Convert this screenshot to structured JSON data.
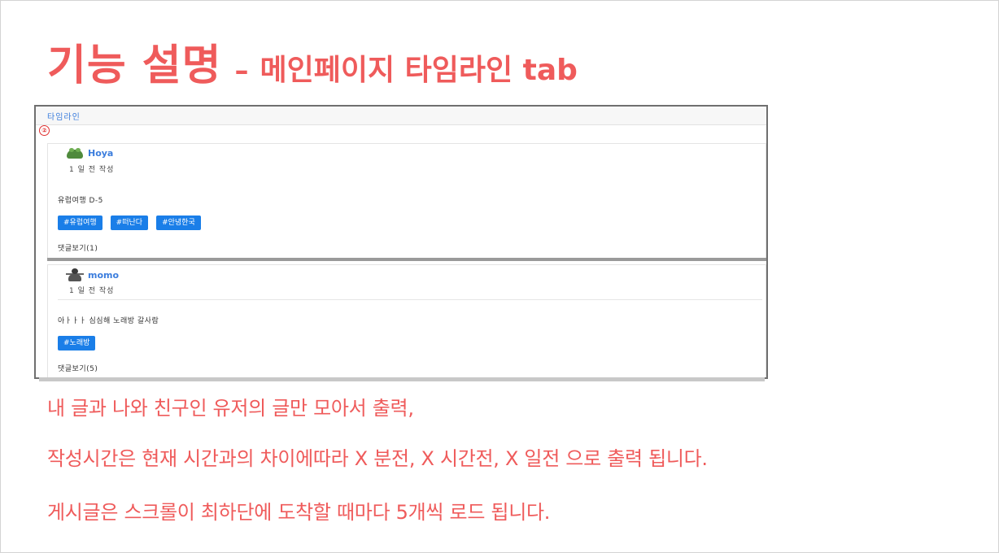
{
  "slide": {
    "title_main": "기능 설명",
    "title_dash": "–",
    "title_sub": "메인페이지 타임라인 tab"
  },
  "screenshot": {
    "tab_label": "타임라인",
    "marker": "②",
    "posts": [
      {
        "avatar": "frog-avatar",
        "username": "Hoya",
        "time": "1 일 전 작성",
        "content": "유럽여행 D-5",
        "tags": [
          "#유럽여행",
          "#떠난다",
          "#안녕한국"
        ],
        "comments": "댓글보기(1)"
      },
      {
        "avatar": "person-avatar",
        "username": "momo",
        "time": "1 일 전 작성",
        "content": "아ㅏㅏㅏ 심심해 노래방 갈사람",
        "tags": [
          "#노래방"
        ],
        "comments": "댓글보기(5)"
      }
    ],
    "tag_color": "#1a7ee8",
    "username_color": "#3b7ddd"
  },
  "description": {
    "lines": [
      "내 글과 나와 친구인 유저의 글만 모아서 출력,",
      "작성시간은 현재 시간과의 차이에따라 X 분전, X 시간전, X 일전 으로 출력 됩니다.",
      "게시글은 스크롤이 최하단에 도착할 때마다 5개씩 로드 됩니다."
    ],
    "color": "#ef5b5b"
  }
}
